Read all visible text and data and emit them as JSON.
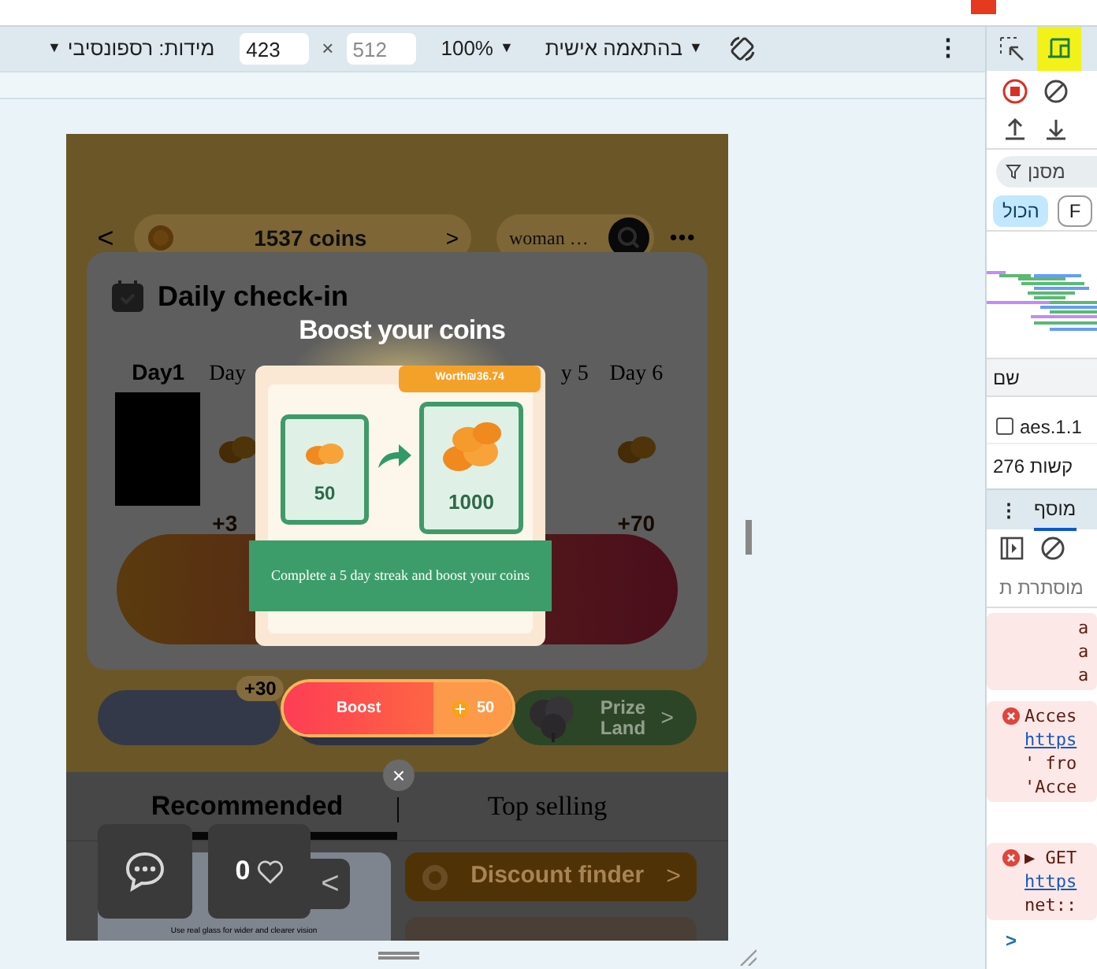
{
  "device_toolbar": {
    "dimensions": "מידות: רספונסיבי",
    "caret": "▼",
    "width": {
      "value": "423"
    },
    "times": "×",
    "height": {
      "placeholder": "512"
    },
    "zoom": "100%",
    "throttling": "בהתאמה אישית",
    "more": "⋮"
  },
  "page": {
    "back": "<",
    "coins": "1537 coins",
    "coins_next": ">",
    "search": "woman …",
    "more": "•••",
    "checkin": {
      "title": "Daily check-in",
      "days": [
        {
          "label": "Day1",
          "kind": "photo"
        },
        {
          "label": "Day",
          "reward": "+3",
          "kind": "coins"
        },
        {
          "kind": "empty"
        },
        {
          "kind": "empty"
        },
        {
          "label": "y 5",
          "kind": "empty"
        },
        {
          "label": "Day 6",
          "reward": "+70",
          "kind": "coins"
        }
      ]
    },
    "bonus_badge": "+30",
    "prize": "Prize Land",
    "prize_next": ">",
    "tabs": [
      {
        "label": "Recommended",
        "selected": true
      },
      {
        "label": "Top selling",
        "selected": false
      }
    ],
    "product_caption": "Use real glass for wider and clearer vision",
    "discount": "Discount finder",
    "discount_next": ">",
    "likes": "0",
    "floating_back": "<"
  },
  "modal": {
    "title": "Boost your coins",
    "worth": "Worth₪36.74",
    "from": "50",
    "to": "1000",
    "message": "Complete a 5 day streak and boost your coins",
    "button": "Boost",
    "cost": "50",
    "close": "×"
  },
  "devtools": {
    "filter": "מסנן",
    "type_filters": [
      {
        "label": "הכול",
        "selected": true
      },
      {
        "label": "F",
        "selected": false
      }
    ],
    "name_header": "שם",
    "requests": [
      {
        "name": "aes.1.1",
        "checked": false
      }
    ],
    "summary": "קשות 276",
    "drawer_more": "⋮",
    "drawer_tab": "מוסף",
    "hidden_label": "מוסתרת ת",
    "messages": [
      {
        "kind": "plain",
        "lines": [
          "a",
          "a",
          "a"
        ]
      },
      {
        "kind": "error",
        "lines": [
          "Acces",
          "https",
          "' fro",
          "'Acce"
        ]
      },
      {
        "kind": "error",
        "lines": [
          "▶ GET",
          "https",
          "net::"
        ]
      }
    ],
    "prompt": ">"
  }
}
